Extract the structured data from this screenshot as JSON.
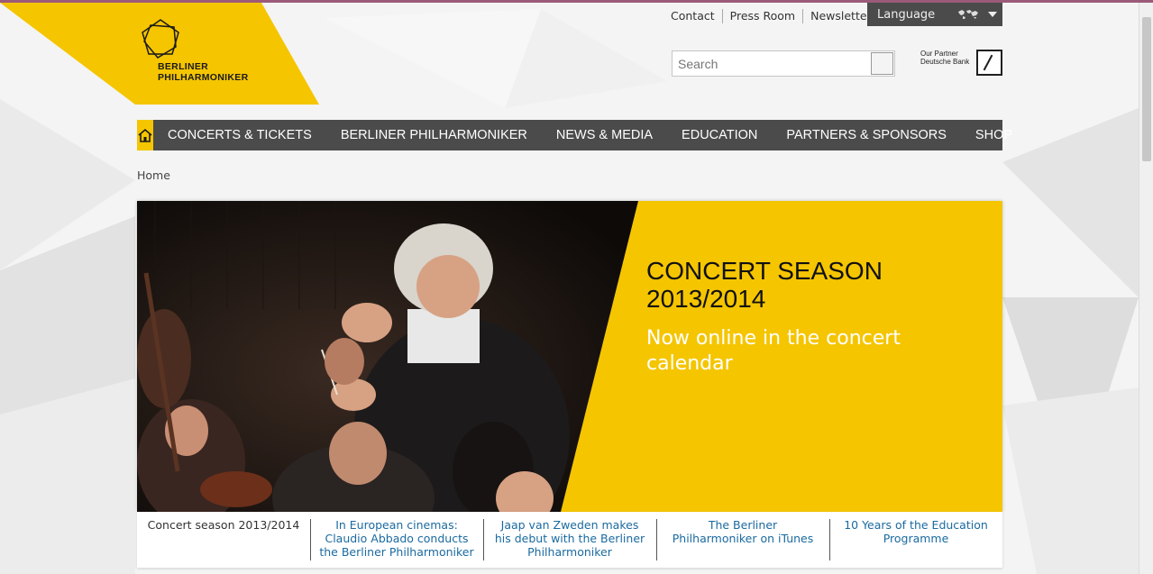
{
  "brand": {
    "line1": "BERLINER",
    "line2": "PHILHARMONIKER"
  },
  "top_links": [
    "Contact",
    "Press Room",
    "Newsletter"
  ],
  "language": {
    "label": "Language"
  },
  "search": {
    "placeholder": "Search"
  },
  "partner": {
    "line1": "Our Partner",
    "line2": "Deutsche Bank"
  },
  "nav": {
    "items": [
      "CONCERTS & TICKETS",
      "BERLINER PHILHARMONIKER",
      "NEWS & MEDIA",
      "EDUCATION",
      "PARTNERS & SPONSORS",
      "SHOP"
    ]
  },
  "breadcrumb": "Home",
  "hero": {
    "title": "CONCERT SEASON 2013/2014",
    "subtitle": "Now online in the concert calendar"
  },
  "tabs": [
    "Concert season 2013/2014",
    "In European cinemas: Claudio Abbado conducts the Berliner Philharmoniker",
    "Jaap van Zweden makes his debut with the Berliner Philharmoniker",
    "The Berliner Philharmoniker on iTunes",
    "10 Years of the Education Programme"
  ],
  "colors": {
    "accent": "#f5c500",
    "nav": "#4b4b4b",
    "link": "#1a6aa0"
  }
}
